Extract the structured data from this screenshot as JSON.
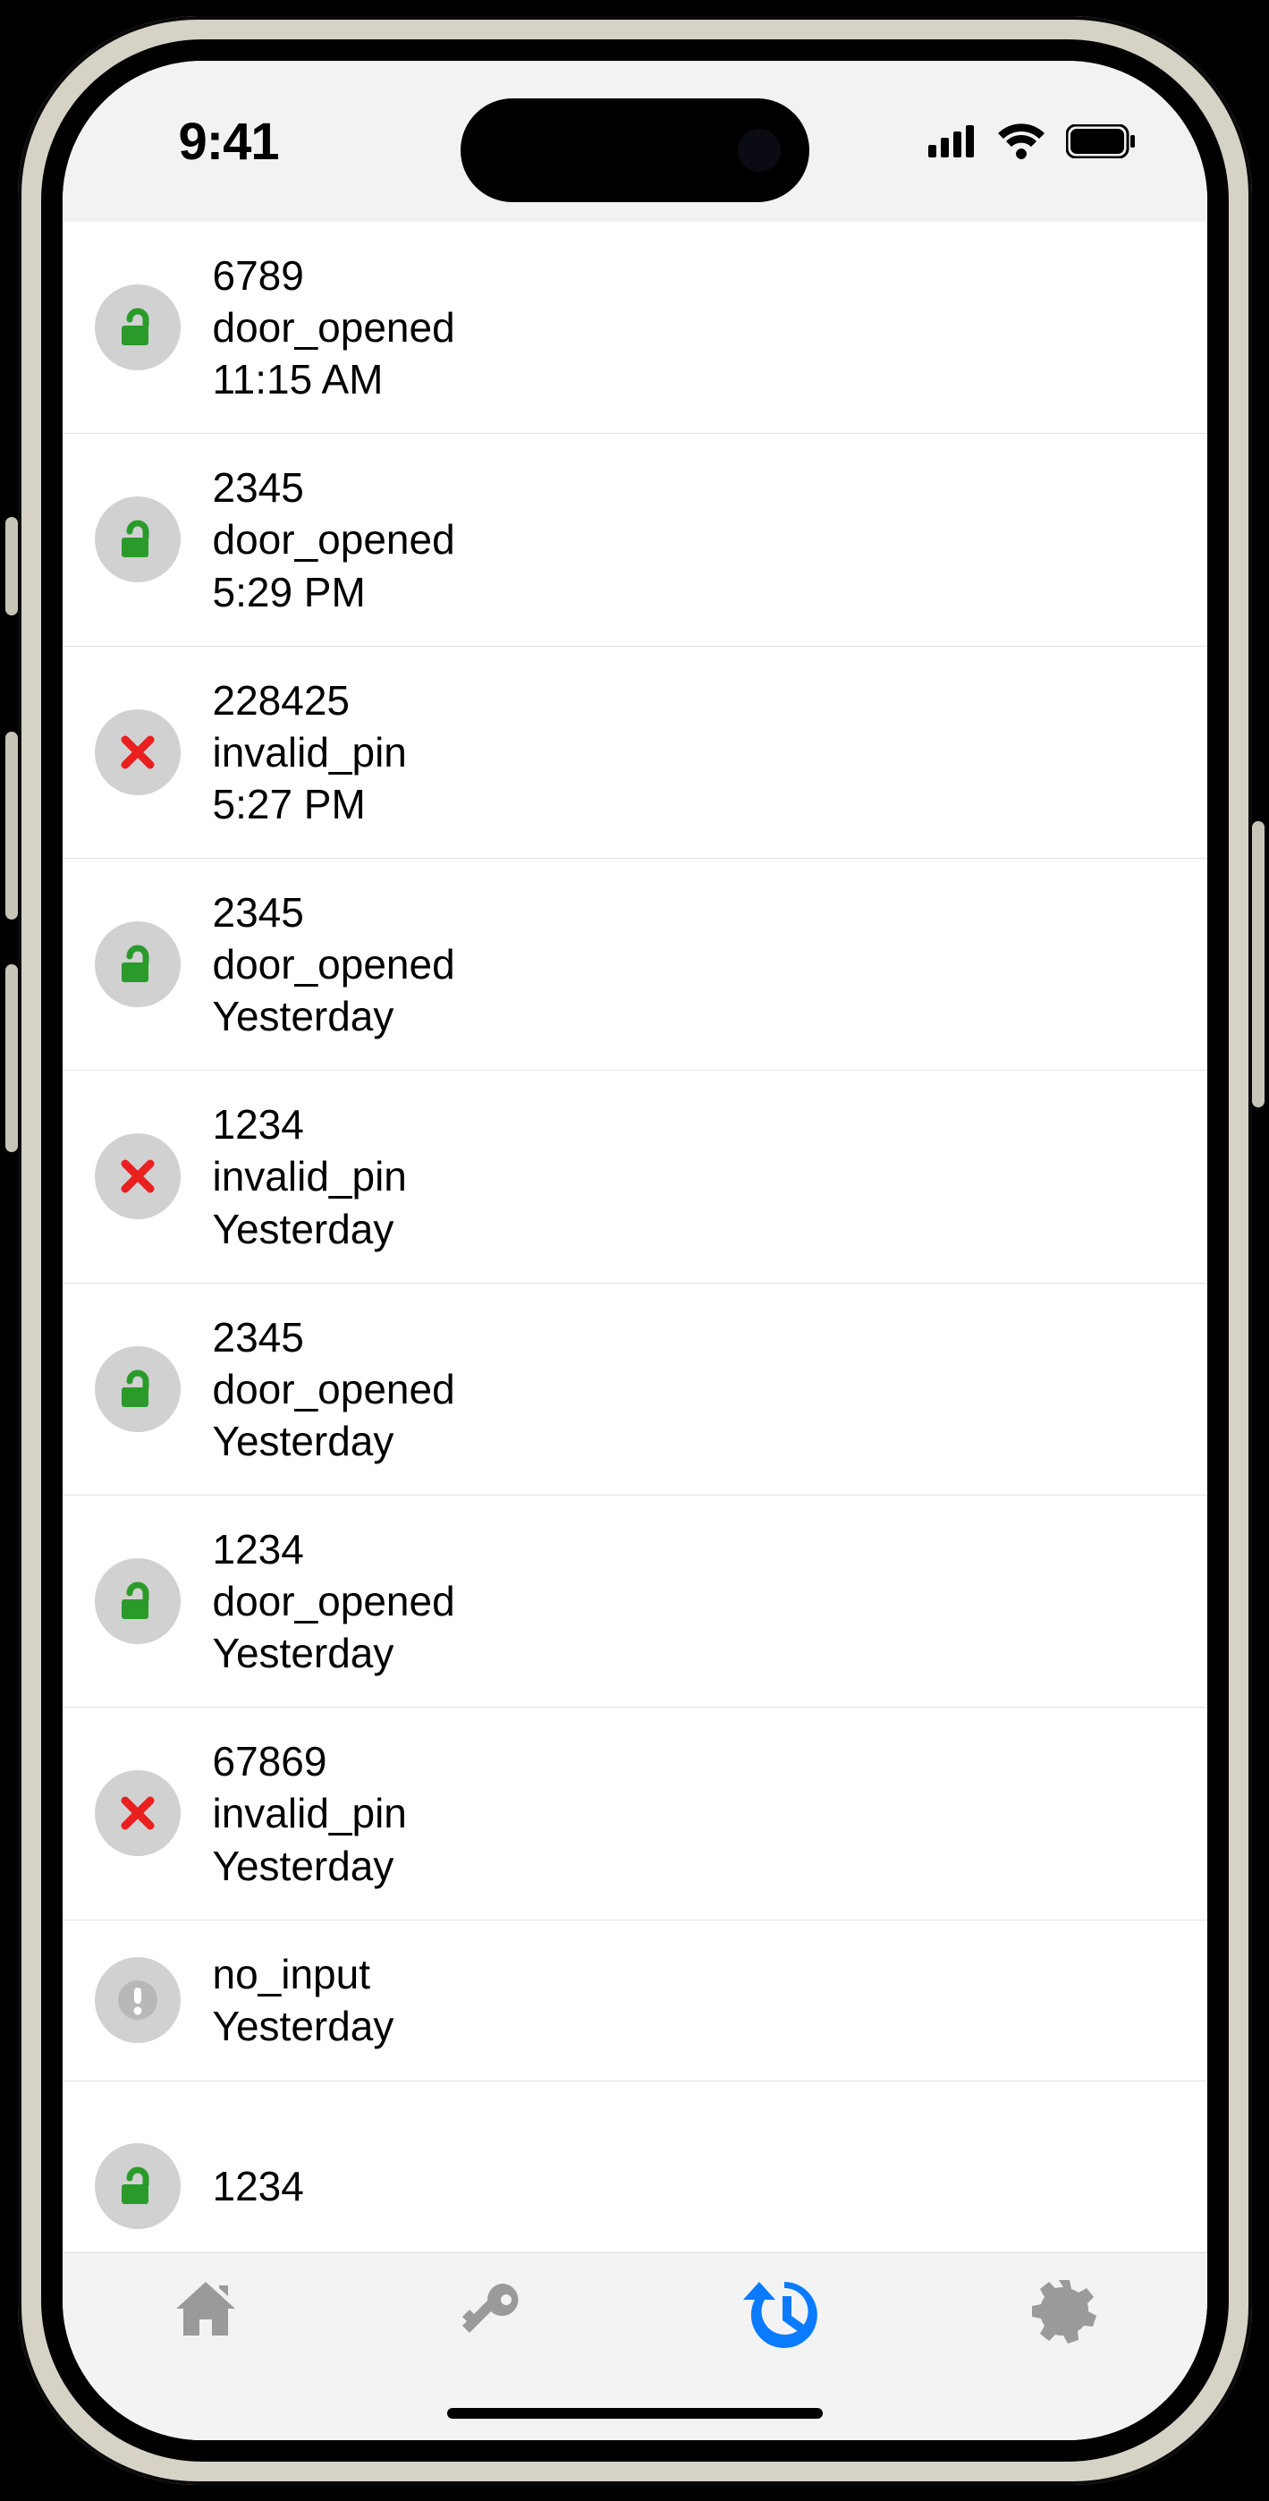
{
  "statusbar": {
    "time": "9:41"
  },
  "events": [
    {
      "pin": "6789",
      "event": "door_opened",
      "time": "11:15 AM",
      "kind": "opened"
    },
    {
      "pin": "2345",
      "event": "door_opened",
      "time": "5:29 PM",
      "kind": "opened"
    },
    {
      "pin": "228425",
      "event": "invalid_pin",
      "time": "5:27 PM",
      "kind": "invalid"
    },
    {
      "pin": "2345",
      "event": "door_opened",
      "time": "Yesterday",
      "kind": "opened"
    },
    {
      "pin": "1234",
      "event": "invalid_pin",
      "time": "Yesterday",
      "kind": "invalid"
    },
    {
      "pin": "2345",
      "event": "door_opened",
      "time": "Yesterday",
      "kind": "opened"
    },
    {
      "pin": "1234",
      "event": "door_opened",
      "time": "Yesterday",
      "kind": "opened"
    },
    {
      "pin": "67869",
      "event": "invalid_pin",
      "time": "Yesterday",
      "kind": "invalid"
    },
    {
      "pin": "",
      "event": "no_input",
      "time": "Yesterday",
      "kind": "noinput"
    },
    {
      "pin": "1234",
      "event": "",
      "time": "",
      "kind": "opened"
    }
  ],
  "tabs": {
    "home": {
      "active": false
    },
    "keys": {
      "active": false
    },
    "history": {
      "active": true
    },
    "settings": {
      "active": false
    }
  },
  "colors": {
    "unlocked": "#2a9b2a",
    "invalid": "#ea1f1f",
    "inactive_tab": "#9a9a9a",
    "active_tab": "#0a7bff"
  }
}
